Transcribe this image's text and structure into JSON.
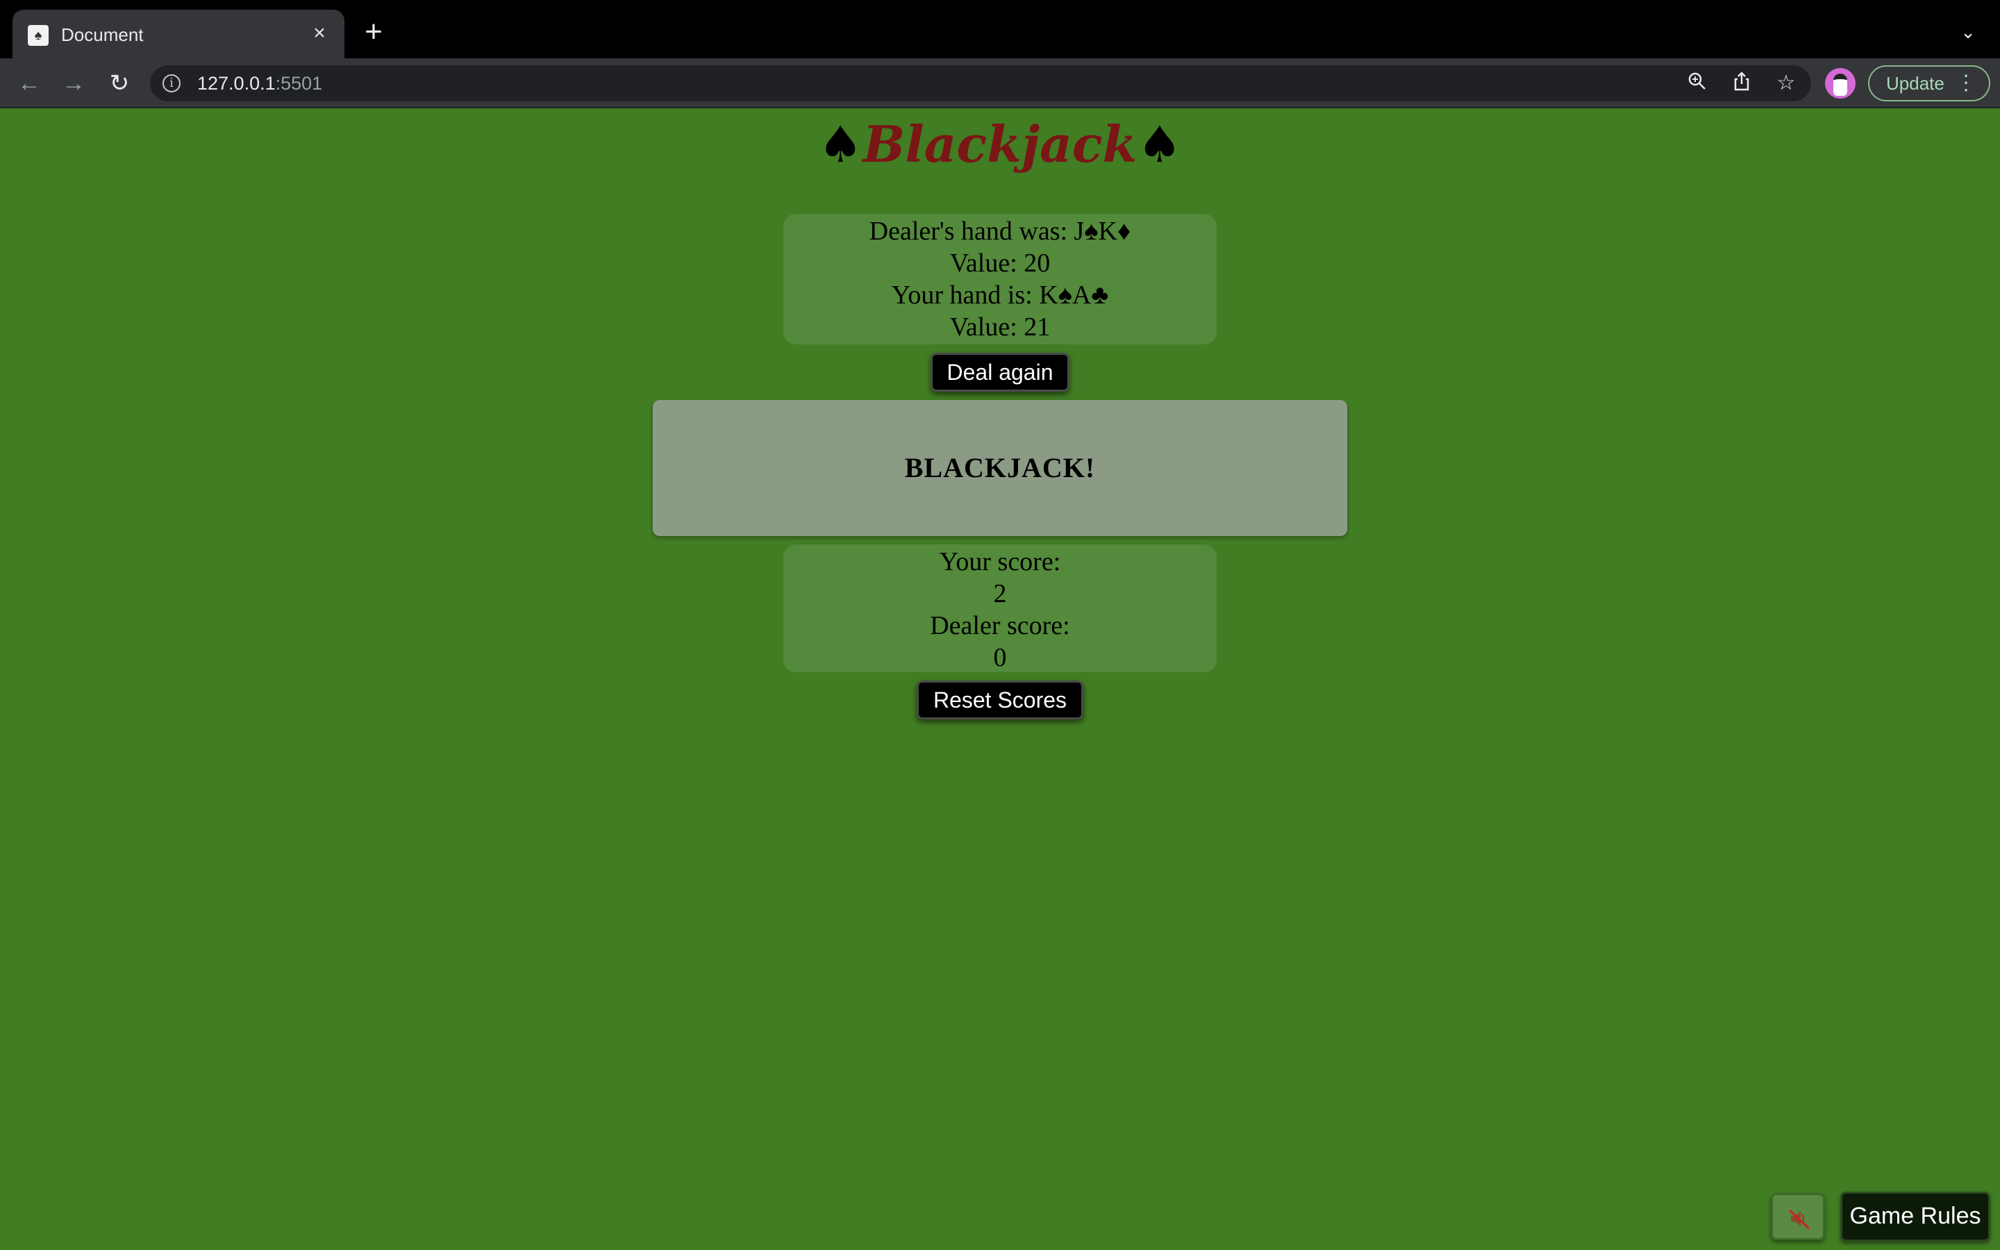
{
  "browser": {
    "tab_title": "Document",
    "tab_favicon": "spade-card-favicon-icon",
    "url_host": "127.0.0.1",
    "url_port": ":5501",
    "update_label": "Update"
  },
  "page": {
    "title_suit_left": "♠",
    "title_text": "Blackjack",
    "title_suit_right": "♠",
    "hand": {
      "dealer_hand": "Dealer's hand was: J♠K♦",
      "dealer_value": "Value: 20",
      "player_hand": "Your hand is: K♠A♣",
      "player_value": "Value: 21"
    },
    "deal_button": "Deal again",
    "result": "BLACKJACK!",
    "scores": {
      "player_label": "Your score:",
      "player_score": "2",
      "dealer_label": "Dealer score:",
      "dealer_score": "0"
    },
    "reset_button": "Reset Scores",
    "rules_button": "Game Rules",
    "sound_toggle_icon": "muted-speaker-icon"
  },
  "colors": {
    "felt_background": "#417d22",
    "panel": "#548a3b",
    "result_box": "#8c9b86",
    "title_word": "#7a1616"
  }
}
